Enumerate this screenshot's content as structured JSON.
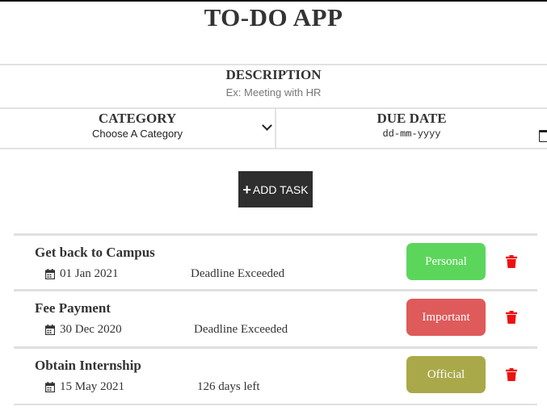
{
  "app": {
    "title": "TO-DO APP"
  },
  "form": {
    "description": {
      "label": "DESCRIPTION",
      "placeholder": "Ex: Meeting with HR"
    },
    "category": {
      "label": "CATEGORY",
      "selected": "Choose A Category"
    },
    "due_date": {
      "label": "DUE DATE",
      "value": "dd-mm-yyyy"
    },
    "add_button": {
      "icon": "plus-icon",
      "label": "ADD TASK"
    }
  },
  "tasks": [
    {
      "title": "Get back to Campus",
      "date": "01 Jan 2021",
      "status": "Deadline Exceeded",
      "category": "Personal",
      "category_color": "#5bd65b"
    },
    {
      "title": "Fee Payment",
      "date": "30 Dec 2020",
      "status": "Deadline Exceeded",
      "category": "Important",
      "category_color": "#df5a5a"
    },
    {
      "title": "Obtain Internship",
      "date": "15 May 2021",
      "status": "126 days left",
      "category": "Official",
      "category_color": "#a9a94a"
    }
  ],
  "colors": {
    "accent_dark": "#2e2e2e",
    "delete_icon": "#ee1111",
    "divider": "#e2e2e2"
  }
}
